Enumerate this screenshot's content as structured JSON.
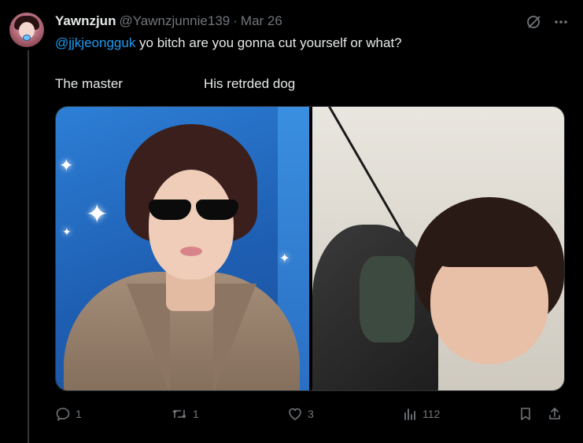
{
  "tweet": {
    "display_name": "Yawnzjun",
    "handle": "@Yawnzjunnie139",
    "separator": "·",
    "date": "Mar 26",
    "mention": "@jjkjeongguk",
    "text": " yo bitch are you gonna cut yourself or what?",
    "caption_left": "The master",
    "caption_right": "His retrded dog"
  },
  "actions": {
    "replies": "1",
    "retweets": "1",
    "likes": "3",
    "views": "112"
  },
  "icons": {
    "grok": "grok-icon",
    "more": "more-icon",
    "reply": "reply-icon",
    "retweet": "retweet-icon",
    "like": "heart-icon",
    "views": "views-icon",
    "bookmark": "bookmark-icon",
    "share": "share-icon"
  },
  "colors": {
    "background": "#000000",
    "text": "#e7e9ea",
    "muted": "#71767b",
    "link": "#1d9bf0"
  }
}
